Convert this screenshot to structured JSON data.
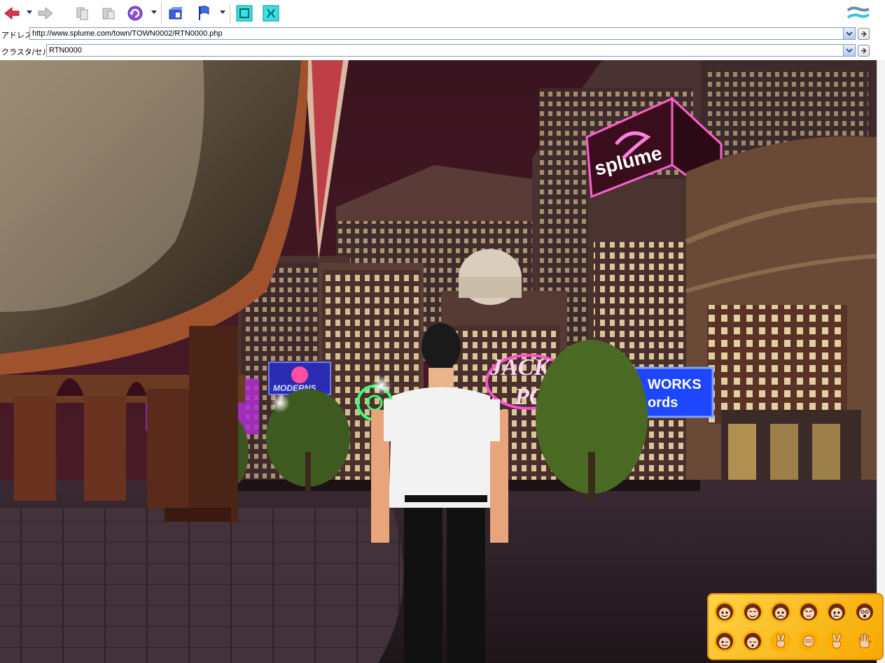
{
  "toolbar": {
    "buttons": [
      {
        "name": "back",
        "icon": "red-back-arrow-icon"
      },
      {
        "name": "forward",
        "icon": "gray-forward-arrow-icon"
      },
      {
        "name": "copy",
        "icon": "gray-copy-icon"
      },
      {
        "name": "paste",
        "icon": "gray-paste-icon"
      },
      {
        "name": "refresh",
        "icon": "purple-refresh-icon"
      },
      {
        "name": "home",
        "icon": "blue-home-icon"
      },
      {
        "name": "flag",
        "icon": "blue-flag-icon"
      },
      {
        "name": "fullscreen",
        "icon": "cyan-fullscreen-icon"
      },
      {
        "name": "shrink",
        "icon": "cyan-shrink-icon"
      }
    ],
    "brand_icon": "splume-logo-icon"
  },
  "address": {
    "label": "アドレス",
    "value": "http://www.splume.com/town/TOWN0002/RTN0000.php"
  },
  "cluster": {
    "label": "クラスタ/セル",
    "value": "RTN0000"
  },
  "scene": {
    "signs": {
      "splume": "splume",
      "moderns": "MODERNS",
      "jackpot_top": "JACK",
      "jackpot_bottom": "POT",
      "works_top": "WORKS",
      "works_bottom": "ords"
    }
  },
  "emotes": {
    "row1": [
      "happy-face-icon",
      "smile-face-icon",
      "sad-face-icon",
      "angry-face-icon",
      "cry-face-icon",
      "surprised-face-icon"
    ],
    "row2": [
      "wink-face-icon",
      "sleepy-face-icon",
      "scissors-hand-icon",
      "rock-hand-icon",
      "peace-hand-icon",
      "wave-hand-icon"
    ]
  },
  "colors": {
    "sky": "#3a1420",
    "neon_pink": "#ff4fd0",
    "neon_blue": "#2f6bff",
    "emote_panel": "#ffc21e"
  }
}
